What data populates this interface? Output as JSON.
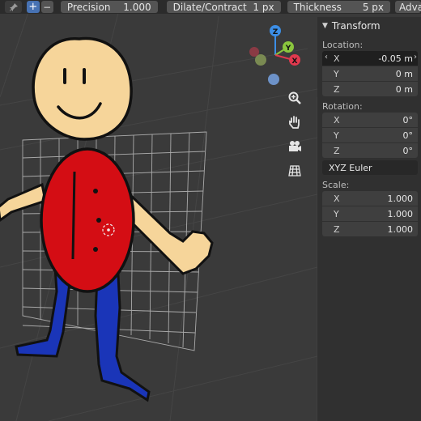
{
  "toolbar": {
    "pin_icon": "pin-icon",
    "plus_label": "+",
    "minus_label": "−",
    "precision_label": "Precision",
    "precision_value": "1.000",
    "dilate_label": "Dilate/Contract",
    "dilate_value": "1 px",
    "thickness_label": "Thickness",
    "thickness_value": "5 px",
    "tab_label": "Adva"
  },
  "gizmo": {
    "z_label": "Z",
    "y_label": "Y",
    "x_label": "X",
    "colors": {
      "x": "#e0394e",
      "y": "#8bc63e",
      "z": "#3c8ee6"
    }
  },
  "nav_icons": [
    "zoom-icon",
    "hand-pan-icon",
    "camera-icon",
    "grid-view-icon"
  ],
  "panel": {
    "title": "Transform",
    "location_label": "Location:",
    "location": [
      {
        "axis": "X",
        "value": "-0.05 m"
      },
      {
        "axis": "Y",
        "value": "0 m"
      },
      {
        "axis": "Z",
        "value": "0 m"
      }
    ],
    "rotation_label": "Rotation:",
    "rotation": [
      {
        "axis": "X",
        "value": "0°"
      },
      {
        "axis": "Y",
        "value": "0°"
      },
      {
        "axis": "Z",
        "value": "0°"
      }
    ],
    "rotation_mode": "XYZ Euler",
    "scale_label": "Scale:",
    "scale": [
      {
        "axis": "X",
        "value": "1.000"
      },
      {
        "axis": "Y",
        "value": "1.000"
      },
      {
        "axis": "Z",
        "value": "1.000"
      }
    ]
  },
  "colors": {
    "skin": "#f6d59a",
    "shirt": "#d40d14",
    "pants": "#1a35b8",
    "accent": "#4772b3"
  }
}
